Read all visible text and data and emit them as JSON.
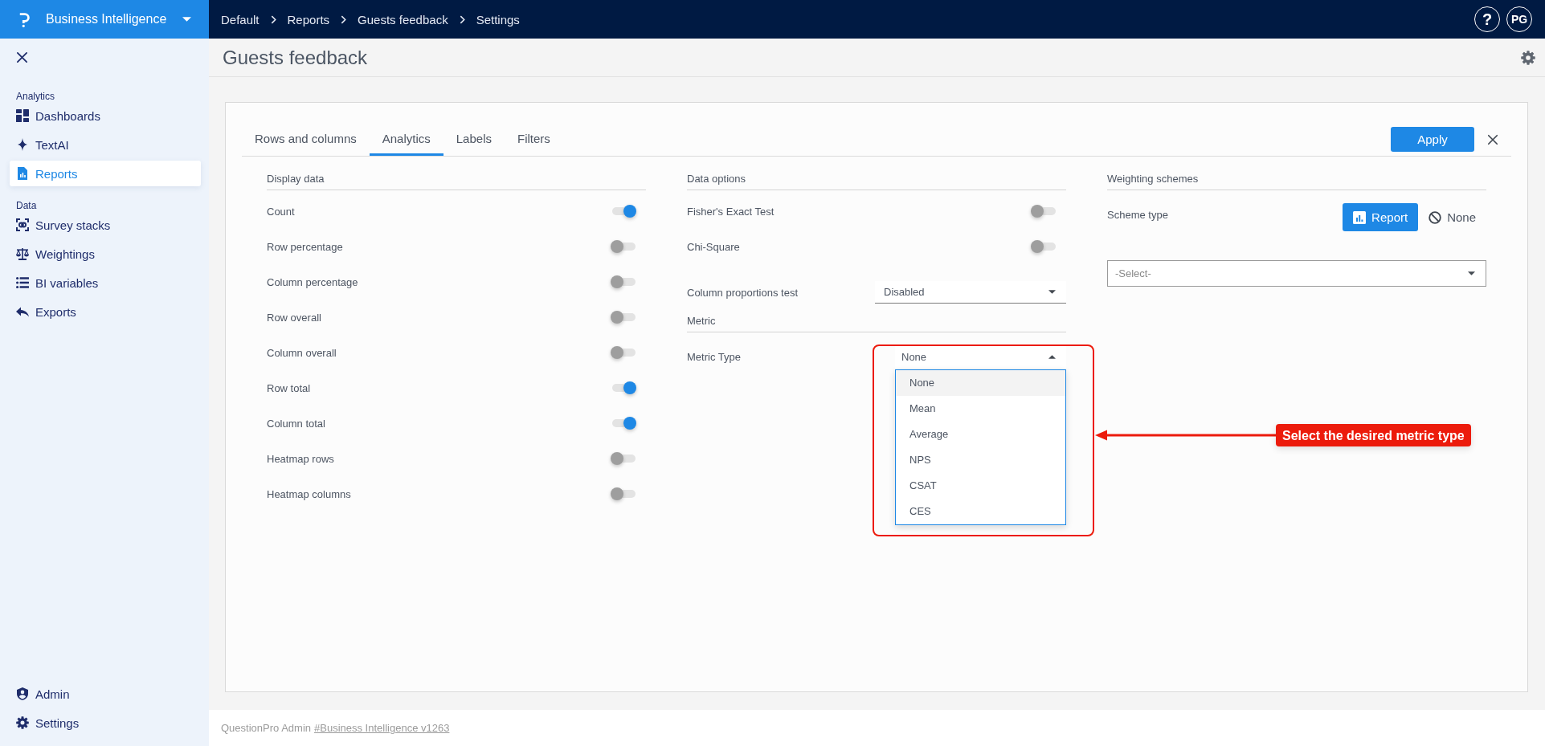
{
  "app": {
    "name": "Business Intelligence"
  },
  "breadcrumbs": [
    {
      "label": "Default"
    },
    {
      "label": "Reports"
    },
    {
      "label": "Guests feedback"
    },
    {
      "label": "Settings"
    }
  ],
  "account": {
    "help": "?",
    "avatar": "PG"
  },
  "sidebar": {
    "sections": [
      {
        "label": "Analytics",
        "items": [
          {
            "label": "Dashboards",
            "selected": false
          },
          {
            "label": "TextAI",
            "selected": false
          },
          {
            "label": "Reports",
            "selected": true
          }
        ]
      },
      {
        "label": "Data",
        "items": [
          {
            "label": "Survey stacks",
            "selected": false
          },
          {
            "label": "Weightings",
            "selected": false
          },
          {
            "label": "BI variables",
            "selected": false
          },
          {
            "label": "Exports",
            "selected": false
          }
        ]
      }
    ],
    "bottom_items": [
      {
        "label": "Admin",
        "selected": false
      },
      {
        "label": "Settings",
        "selected": false
      }
    ]
  },
  "page": {
    "title": "Guests feedback"
  },
  "tabs": [
    {
      "label": "Rows and columns",
      "selected": false
    },
    {
      "label": "Analytics",
      "selected": true
    },
    {
      "label": "Labels",
      "selected": false
    },
    {
      "label": "Filters",
      "selected": false
    }
  ],
  "apply_button": {
    "label": "Apply"
  },
  "display_data": {
    "heading": "Display data",
    "options": [
      {
        "label": "Count",
        "on": true
      },
      {
        "label": "Row percentage",
        "on": false
      },
      {
        "label": "Column percentage",
        "on": false
      },
      {
        "label": "Row overall",
        "on": false
      },
      {
        "label": "Column overall",
        "on": false
      },
      {
        "label": "Row total",
        "on": true
      },
      {
        "label": "Column total",
        "on": true
      },
      {
        "label": "Heatmap rows",
        "on": false
      },
      {
        "label": "Heatmap columns",
        "on": false
      }
    ]
  },
  "data_options": {
    "heading": "Data options",
    "toggles": [
      {
        "label": "Fisher's Exact Test",
        "on": false
      },
      {
        "label": "Chi-Square",
        "on": false
      }
    ],
    "column_proportions_test": {
      "label": "Column proportions test",
      "value": "Disabled"
    }
  },
  "metric": {
    "heading": "Metric",
    "metric_type": {
      "label": "Metric Type",
      "value": "None",
      "expanded": true,
      "options": [
        {
          "label": "None",
          "selected": true
        },
        {
          "label": "Mean",
          "selected": false
        },
        {
          "label": "Average",
          "selected": false
        },
        {
          "label": "NPS",
          "selected": false
        },
        {
          "label": "CSAT",
          "selected": false
        },
        {
          "label": "CES",
          "selected": false
        }
      ]
    }
  },
  "weighting_schemes": {
    "heading": "Weighting schemes",
    "scheme_type": {
      "label": "Scheme type",
      "options": [
        {
          "label": "Report",
          "selected": true
        },
        {
          "label": "None",
          "selected": false
        }
      ]
    },
    "scheme_select": {
      "placeholder": "-Select-"
    }
  },
  "annotation": {
    "text": "Select the desired metric type"
  },
  "footer": {
    "text": "QuestionPro Admin",
    "link": "#Business Intelligence v1263"
  }
}
